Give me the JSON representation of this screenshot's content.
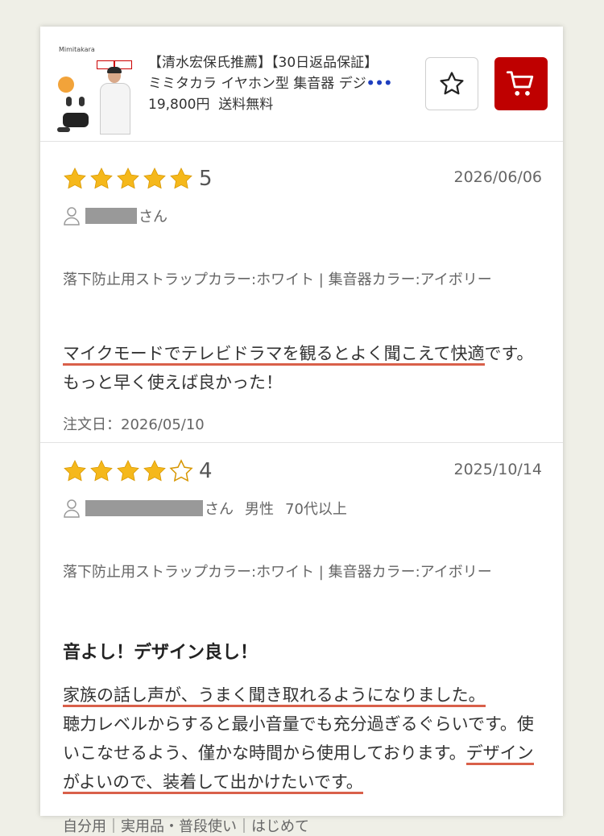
{
  "product": {
    "thumb_brand": "Mimitakara",
    "title_line1": "【清水宏保氏推薦】【30日返品保証】",
    "title_line2": "ミミタカラ イヤホン型 集音器 デジ",
    "ellipsis": "•••",
    "price": "19,800円",
    "shipping": "送料無料"
  },
  "icons": {
    "favorite": "star-outline-icon",
    "cart": "cart-icon",
    "user": "user-icon",
    "star": "star-icon"
  },
  "colors": {
    "star": "#f5b81b",
    "cart_button": "#bf0000",
    "underline": "#d9604a"
  },
  "reviews": [
    {
      "rating": 5,
      "rating_label": "5",
      "date": "2026/06/06",
      "reviewer_suffix": "さん",
      "gender": "",
      "age": "",
      "variant": "落下防止用ストラップカラー:ホワイト | 集音器カラー:アイボリー",
      "title": "",
      "body_underlined": "マイクモードでテレビドラマを観るとよく聞こえて快適",
      "body_rest": "です。もっと早く使えば良かった！",
      "meta": "注文日：2026/05/10"
    },
    {
      "rating": 4,
      "rating_label": "4",
      "date": "2025/10/14",
      "reviewer_suffix": "さん",
      "gender": "男性",
      "age": "70代以上",
      "variant": "落下防止用ストラップカラー:ホワイト | 集音器カラー:アイボリー",
      "title": "音よし！デザイン良し！",
      "body_underlined": "家族の話し声が、うまく聞き取れるようになりました。",
      "body_mid": "聴力レベルからすると最小音量でも充分過ぎるぐらいです。使いこなせるよう、僅かな時間から使用しておりま",
      "body_mid2": "す。",
      "body_underlined2": "デザインがよいので、装着して出かけたいです。",
      "meta": "自分用｜実用品・普段使い｜はじめて"
    }
  ]
}
